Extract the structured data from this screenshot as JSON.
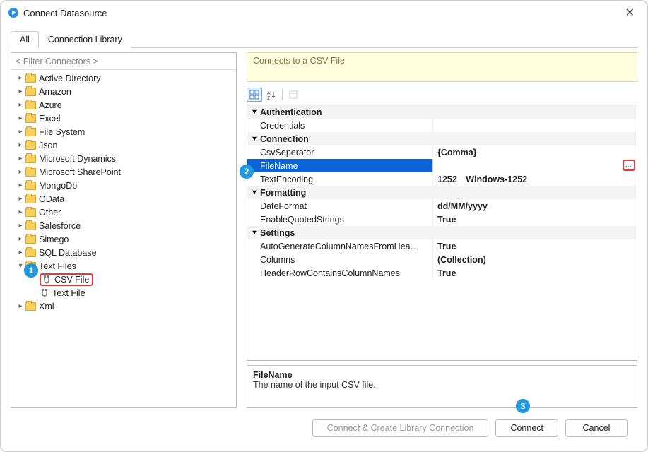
{
  "window": {
    "title": "Connect Datasource"
  },
  "tabs": {
    "all": "All",
    "library": "Connection Library"
  },
  "filter_placeholder": "< Filter Connectors >",
  "tree": {
    "items": [
      {
        "label": "Active Directory",
        "expanded": false,
        "indent": 0,
        "type": "folder"
      },
      {
        "label": "Amazon",
        "expanded": false,
        "indent": 0,
        "type": "folder"
      },
      {
        "label": "Azure",
        "expanded": false,
        "indent": 0,
        "type": "folder"
      },
      {
        "label": "Excel",
        "expanded": false,
        "indent": 0,
        "type": "folder"
      },
      {
        "label": "File System",
        "expanded": false,
        "indent": 0,
        "type": "folder"
      },
      {
        "label": "Json",
        "expanded": false,
        "indent": 0,
        "type": "folder"
      },
      {
        "label": "Microsoft Dynamics",
        "expanded": false,
        "indent": 0,
        "type": "folder"
      },
      {
        "label": "Microsoft SharePoint",
        "expanded": false,
        "indent": 0,
        "type": "folder"
      },
      {
        "label": "MongoDb",
        "expanded": false,
        "indent": 0,
        "type": "folder"
      },
      {
        "label": "OData",
        "expanded": false,
        "indent": 0,
        "type": "folder"
      },
      {
        "label": "Other",
        "expanded": false,
        "indent": 0,
        "type": "folder"
      },
      {
        "label": "Salesforce",
        "expanded": false,
        "indent": 0,
        "type": "folder"
      },
      {
        "label": "Simego",
        "expanded": false,
        "indent": 0,
        "type": "folder"
      },
      {
        "label": "SQL Database",
        "expanded": false,
        "indent": 0,
        "type": "folder"
      },
      {
        "label": "Text Files",
        "expanded": true,
        "indent": 0,
        "type": "folder"
      },
      {
        "label": "CSV File",
        "expanded": false,
        "indent": 1,
        "type": "connector",
        "highlight": true
      },
      {
        "label": "Text File",
        "expanded": false,
        "indent": 1,
        "type": "connector"
      },
      {
        "label": "Xml",
        "expanded": false,
        "indent": 0,
        "type": "folder"
      }
    ]
  },
  "description": "Connects to a CSV File",
  "toolbar": {
    "categorized": "Categorized",
    "alphabetical": "Alphabetical",
    "pages": "Property Pages"
  },
  "props": {
    "cats": {
      "auth": "Authentication",
      "conn": "Connection",
      "fmt": "Formatting",
      "set": "Settings"
    },
    "rows": {
      "credentials": {
        "name": "Credentials",
        "val": ""
      },
      "csvsep": {
        "name": "CsvSeperator",
        "val": "{Comma}"
      },
      "filename": {
        "name": "FileName",
        "val": ""
      },
      "textenc": {
        "name": "TextEncoding",
        "val": "1252 Windows-1252"
      },
      "datefmt": {
        "name": "DateFormat",
        "val": "dd/MM/yyyy"
      },
      "enquoted": {
        "name": "EnableQuotedStrings",
        "val": "True"
      },
      "autogen": {
        "name": "AutoGenerateColumnNamesFromHeaderR",
        "val": "True"
      },
      "columns": {
        "name": "Columns",
        "val": "(Collection)"
      },
      "headerrow": {
        "name": "HeaderRowContainsColumnNames",
        "val": "True"
      }
    }
  },
  "help": {
    "title": "FileName",
    "desc": "The name of the input CSV file."
  },
  "buttons": {
    "createlib": "Connect & Create Library Connection",
    "connect": "Connect",
    "cancel": "Cancel"
  },
  "badges": {
    "b1": "1",
    "b2": "2",
    "b3": "3"
  }
}
